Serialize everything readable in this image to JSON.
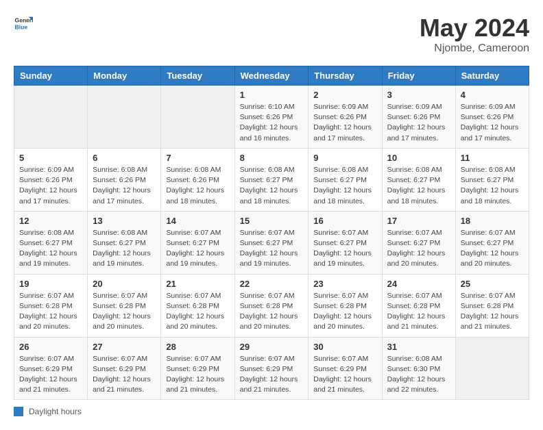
{
  "header": {
    "logo_general": "General",
    "logo_blue": "Blue",
    "month_year": "May 2024",
    "location": "Njombe, Cameroon"
  },
  "weekdays": [
    "Sunday",
    "Monday",
    "Tuesday",
    "Wednesday",
    "Thursday",
    "Friday",
    "Saturday"
  ],
  "legend": {
    "label": "Daylight hours"
  },
  "weeks": [
    [
      {
        "day": "",
        "info": ""
      },
      {
        "day": "",
        "info": ""
      },
      {
        "day": "",
        "info": ""
      },
      {
        "day": "1",
        "info": "Sunrise: 6:10 AM\nSunset: 6:26 PM\nDaylight: 12 hours and 16 minutes."
      },
      {
        "day": "2",
        "info": "Sunrise: 6:09 AM\nSunset: 6:26 PM\nDaylight: 12 hours and 17 minutes."
      },
      {
        "day": "3",
        "info": "Sunrise: 6:09 AM\nSunset: 6:26 PM\nDaylight: 12 hours and 17 minutes."
      },
      {
        "day": "4",
        "info": "Sunrise: 6:09 AM\nSunset: 6:26 PM\nDaylight: 12 hours and 17 minutes."
      }
    ],
    [
      {
        "day": "5",
        "info": "Sunrise: 6:09 AM\nSunset: 6:26 PM\nDaylight: 12 hours and 17 minutes."
      },
      {
        "day": "6",
        "info": "Sunrise: 6:08 AM\nSunset: 6:26 PM\nDaylight: 12 hours and 17 minutes."
      },
      {
        "day": "7",
        "info": "Sunrise: 6:08 AM\nSunset: 6:26 PM\nDaylight: 12 hours and 18 minutes."
      },
      {
        "day": "8",
        "info": "Sunrise: 6:08 AM\nSunset: 6:27 PM\nDaylight: 12 hours and 18 minutes."
      },
      {
        "day": "9",
        "info": "Sunrise: 6:08 AM\nSunset: 6:27 PM\nDaylight: 12 hours and 18 minutes."
      },
      {
        "day": "10",
        "info": "Sunrise: 6:08 AM\nSunset: 6:27 PM\nDaylight: 12 hours and 18 minutes."
      },
      {
        "day": "11",
        "info": "Sunrise: 6:08 AM\nSunset: 6:27 PM\nDaylight: 12 hours and 18 minutes."
      }
    ],
    [
      {
        "day": "12",
        "info": "Sunrise: 6:08 AM\nSunset: 6:27 PM\nDaylight: 12 hours and 19 minutes."
      },
      {
        "day": "13",
        "info": "Sunrise: 6:08 AM\nSunset: 6:27 PM\nDaylight: 12 hours and 19 minutes."
      },
      {
        "day": "14",
        "info": "Sunrise: 6:07 AM\nSunset: 6:27 PM\nDaylight: 12 hours and 19 minutes."
      },
      {
        "day": "15",
        "info": "Sunrise: 6:07 AM\nSunset: 6:27 PM\nDaylight: 12 hours and 19 minutes."
      },
      {
        "day": "16",
        "info": "Sunrise: 6:07 AM\nSunset: 6:27 PM\nDaylight: 12 hours and 19 minutes."
      },
      {
        "day": "17",
        "info": "Sunrise: 6:07 AM\nSunset: 6:27 PM\nDaylight: 12 hours and 20 minutes."
      },
      {
        "day": "18",
        "info": "Sunrise: 6:07 AM\nSunset: 6:27 PM\nDaylight: 12 hours and 20 minutes."
      }
    ],
    [
      {
        "day": "19",
        "info": "Sunrise: 6:07 AM\nSunset: 6:28 PM\nDaylight: 12 hours and 20 minutes."
      },
      {
        "day": "20",
        "info": "Sunrise: 6:07 AM\nSunset: 6:28 PM\nDaylight: 12 hours and 20 minutes."
      },
      {
        "day": "21",
        "info": "Sunrise: 6:07 AM\nSunset: 6:28 PM\nDaylight: 12 hours and 20 minutes."
      },
      {
        "day": "22",
        "info": "Sunrise: 6:07 AM\nSunset: 6:28 PM\nDaylight: 12 hours and 20 minutes."
      },
      {
        "day": "23",
        "info": "Sunrise: 6:07 AM\nSunset: 6:28 PM\nDaylight: 12 hours and 20 minutes."
      },
      {
        "day": "24",
        "info": "Sunrise: 6:07 AM\nSunset: 6:28 PM\nDaylight: 12 hours and 21 minutes."
      },
      {
        "day": "25",
        "info": "Sunrise: 6:07 AM\nSunset: 6:28 PM\nDaylight: 12 hours and 21 minutes."
      }
    ],
    [
      {
        "day": "26",
        "info": "Sunrise: 6:07 AM\nSunset: 6:29 PM\nDaylight: 12 hours and 21 minutes."
      },
      {
        "day": "27",
        "info": "Sunrise: 6:07 AM\nSunset: 6:29 PM\nDaylight: 12 hours and 21 minutes."
      },
      {
        "day": "28",
        "info": "Sunrise: 6:07 AM\nSunset: 6:29 PM\nDaylight: 12 hours and 21 minutes."
      },
      {
        "day": "29",
        "info": "Sunrise: 6:07 AM\nSunset: 6:29 PM\nDaylight: 12 hours and 21 minutes."
      },
      {
        "day": "30",
        "info": "Sunrise: 6:07 AM\nSunset: 6:29 PM\nDaylight: 12 hours and 21 minutes."
      },
      {
        "day": "31",
        "info": "Sunrise: 6:08 AM\nSunset: 6:30 PM\nDaylight: 12 hours and 22 minutes."
      },
      {
        "day": "",
        "info": ""
      }
    ]
  ]
}
